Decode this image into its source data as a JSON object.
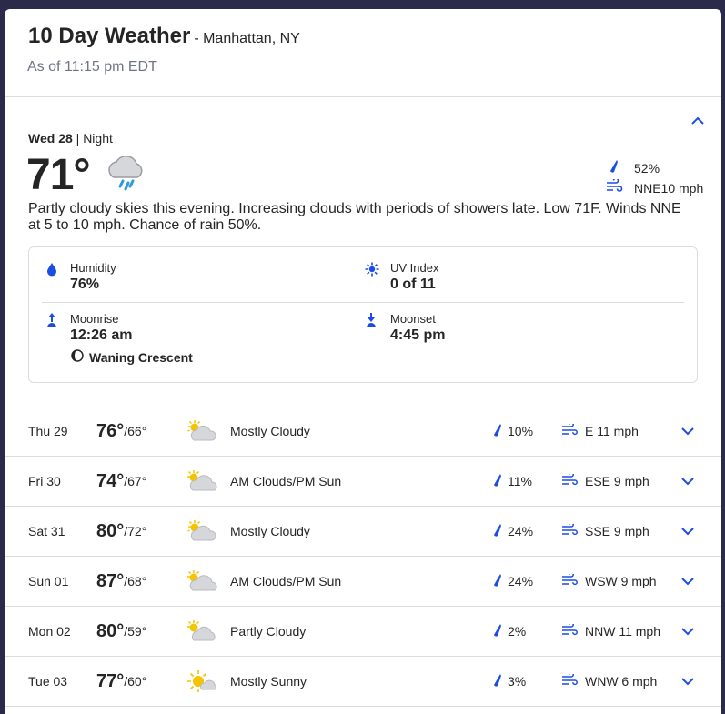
{
  "header": {
    "title": "10 Day Weather",
    "location": "- Manhattan, NY",
    "as_of": "As of 11:15 pm EDT"
  },
  "today": {
    "day": "Wed 28",
    "separator": " | ",
    "period": "Night",
    "temp": "71°",
    "icon": "cloud-rain-icon",
    "precip": "52%",
    "wind": "NNE10 mph",
    "narrative": "Partly cloudy skies this evening. Increasing clouds with periods of showers late. Low 71F. Winds NNE at 5 to 10 mph. Chance of rain 50%.",
    "details": {
      "humidity_label": "Humidity",
      "humidity_value": "76%",
      "uv_label": "UV Index",
      "uv_value": "0 of 11",
      "moonrise_label": "Moonrise",
      "moonrise_value": "12:26 am",
      "moonset_label": "Moonset",
      "moonset_value": "4:45 pm",
      "moon_phase": "Waning Crescent"
    }
  },
  "days": [
    {
      "day": "Thu 29",
      "hi": "76°",
      "lo": "/66°",
      "icon": "mostly-cloudy-icon",
      "condition": "Mostly Cloudy",
      "precip": "10%",
      "wind": "E 11 mph"
    },
    {
      "day": "Fri 30",
      "hi": "74°",
      "lo": "/67°",
      "icon": "partly-sunny-icon",
      "condition": "AM Clouds/PM Sun",
      "precip": "11%",
      "wind": "ESE 9 mph"
    },
    {
      "day": "Sat 31",
      "hi": "80°",
      "lo": "/72°",
      "icon": "mostly-cloudy-icon",
      "condition": "Mostly Cloudy",
      "precip": "24%",
      "wind": "SSE 9 mph"
    },
    {
      "day": "Sun 01",
      "hi": "87°",
      "lo": "/68°",
      "icon": "partly-sunny-icon",
      "condition": "AM Clouds/PM Sun",
      "precip": "24%",
      "wind": "WSW 9 mph"
    },
    {
      "day": "Mon 02",
      "hi": "80°",
      "lo": "/59°",
      "icon": "partly-cloudy-icon",
      "condition": "Partly Cloudy",
      "precip": "2%",
      "wind": "NNW 11 mph"
    },
    {
      "day": "Tue 03",
      "hi": "77°",
      "lo": "/60°",
      "icon": "mostly-sunny-icon",
      "condition": "Mostly Sunny",
      "precip": "3%",
      "wind": "WNW 6 mph"
    }
  ],
  "colors": {
    "accent": "#1b4de4",
    "text": "#252525",
    "muted": "#6f7585",
    "border": "#dcdcdc",
    "sun": "#f5c400",
    "cloud": "#d6d7da"
  }
}
